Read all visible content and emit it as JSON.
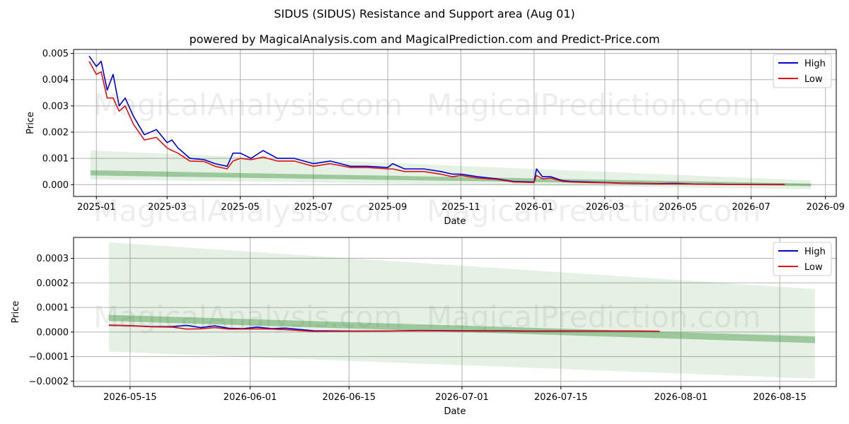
{
  "title": "SIDUS (SIDUS) Resistance and Support area (Aug 01)",
  "subtitle": "powered by MagicalAnalysis.com and MagicalPrediction.com and Predict-Price.com",
  "watermarks": [
    "MagicalAnalysis.com",
    "MagicalPrediction.com"
  ],
  "colors": {
    "high": "#0000cc",
    "low": "#dd1111",
    "band": "#2e8b2e",
    "grid": "#b0b0b0"
  },
  "chart_data": [
    {
      "type": "line",
      "xlabel": "Date",
      "ylabel": "Price",
      "xlim": [
        "2024-12-13",
        "2026-09-10"
      ],
      "ylim": [
        -0.00045,
        0.00515
      ],
      "x_ticks": [
        "2025-01",
        "2025-03",
        "2025-05",
        "2025-07",
        "2025-09",
        "2025-11",
        "2026-01",
        "2026-03",
        "2026-05",
        "2026-07",
        "2026-09"
      ],
      "y_ticks": [
        "0.000",
        "0.001",
        "0.002",
        "0.003",
        "0.004",
        "0.005"
      ],
      "legend": {
        "position": "top-right",
        "entries": [
          "High",
          "Low"
        ]
      },
      "grid": true,
      "series": [
        {
          "name": "High",
          "x": [
            "2024-12-26",
            "2025-01-01",
            "2025-01-05",
            "2025-01-10",
            "2025-01-15",
            "2025-01-20",
            "2025-01-25",
            "2025-02-01",
            "2025-02-10",
            "2025-02-20",
            "2025-03-01",
            "2025-03-05",
            "2025-03-10",
            "2025-03-20",
            "2025-04-01",
            "2025-04-10",
            "2025-04-20",
            "2025-04-25",
            "2025-05-01",
            "2025-05-10",
            "2025-05-20",
            "2025-06-01",
            "2025-06-15",
            "2025-07-01",
            "2025-07-15",
            "2025-08-01",
            "2025-08-15",
            "2025-09-01",
            "2025-09-05",
            "2025-09-15",
            "2025-10-01",
            "2025-10-15",
            "2025-10-25",
            "2025-11-01",
            "2025-11-15",
            "2025-12-01",
            "2025-12-15",
            "2026-01-01",
            "2026-01-03",
            "2026-01-08",
            "2026-01-15",
            "2026-01-25",
            "2026-02-01",
            "2026-02-15",
            "2026-03-01",
            "2026-03-15",
            "2026-04-01",
            "2026-04-15",
            "2026-04-28",
            "2026-05-15",
            "2026-06-01",
            "2026-06-15",
            "2026-07-01",
            "2026-07-15",
            "2026-07-29"
          ],
          "y": [
            0.0049,
            0.0045,
            0.0047,
            0.0036,
            0.0042,
            0.003,
            0.0033,
            0.0026,
            0.0019,
            0.0021,
            0.0016,
            0.0017,
            0.0014,
            0.001,
            0.00095,
            0.0008,
            0.0007,
            0.0012,
            0.0012,
            0.001,
            0.0013,
            0.001,
            0.001,
            0.0008,
            0.0009,
            0.0007,
            0.0007,
            0.00065,
            0.0008,
            0.0006,
            0.0006,
            0.0005,
            0.0004,
            0.0004,
            0.0003,
            0.00022,
            0.00012,
            0.0001,
            0.0006,
            0.0003,
            0.0003,
            0.00015,
            0.00012,
            0.0001,
            8e-05,
            6e-05,
            5e-05,
            4e-05,
            5e-05,
            2.5e-05,
            2e-05,
            1e-05,
            1e-05,
            6e-06,
            6e-06
          ]
        },
        {
          "name": "Low",
          "x": [
            "2024-12-26",
            "2025-01-01",
            "2025-01-05",
            "2025-01-10",
            "2025-01-15",
            "2025-01-20",
            "2025-01-25",
            "2025-02-01",
            "2025-02-10",
            "2025-02-20",
            "2025-03-01",
            "2025-03-05",
            "2025-03-10",
            "2025-03-20",
            "2025-04-01",
            "2025-04-10",
            "2025-04-20",
            "2025-04-25",
            "2025-05-01",
            "2025-05-10",
            "2025-05-20",
            "2025-06-01",
            "2025-06-15",
            "2025-07-01",
            "2025-07-15",
            "2025-08-01",
            "2025-08-15",
            "2025-09-01",
            "2025-09-05",
            "2025-09-15",
            "2025-10-01",
            "2025-10-15",
            "2025-10-25",
            "2025-11-01",
            "2025-11-15",
            "2025-12-01",
            "2025-12-15",
            "2026-01-01",
            "2026-01-03",
            "2026-01-08",
            "2026-01-15",
            "2026-01-25",
            "2026-02-01",
            "2026-02-15",
            "2026-03-01",
            "2026-03-15",
            "2026-04-01",
            "2026-04-15",
            "2026-04-28",
            "2026-05-15",
            "2026-06-01",
            "2026-06-15",
            "2026-07-01",
            "2026-07-15",
            "2026-07-29"
          ],
          "y": [
            0.0047,
            0.0042,
            0.0043,
            0.0033,
            0.0033,
            0.0028,
            0.003,
            0.0023,
            0.0017,
            0.0018,
            0.0014,
            0.0013,
            0.0012,
            0.0009,
            0.00088,
            0.0007,
            0.0006,
            0.0009,
            0.001,
            0.00095,
            0.00105,
            0.0009,
            0.0009,
            0.0007,
            0.0008,
            0.00065,
            0.00065,
            0.0006,
            0.0006,
            0.0005,
            0.0005,
            0.0004,
            0.0003,
            0.00035,
            0.00025,
            0.0002,
            0.0001,
            8e-05,
            0.00035,
            0.00022,
            0.00025,
            0.00012,
            0.0001,
            8e-05,
            7e-05,
            5e-05,
            4e-05,
            3e-05,
            3e-05,
            2e-05,
            1e-05,
            5e-06,
            5e-06,
            4e-06,
            5e-06
          ]
        }
      ],
      "bands": [
        {
          "x": [
            "2024-12-27",
            "2026-08-20"
          ],
          "upper": [
            0.0013,
            0.00016
          ],
          "lower": [
            0.0002,
            -0.00018
          ],
          "opacity": 0.12
        },
        {
          "x": [
            "2024-12-27",
            "2026-08-20"
          ],
          "upper": [
            0.00055,
            4e-05
          ],
          "lower": [
            0.00035,
            -6e-05
          ],
          "opacity": 0.4
        }
      ]
    },
    {
      "type": "line",
      "xlabel": "Date",
      "ylabel": "Price",
      "xlim": [
        "2026-05-07",
        "2026-08-23"
      ],
      "ylim": [
        -0.000222,
        0.000385
      ],
      "x_ticks": [
        "2026-05-15",
        "2026-06-01",
        "2026-06-15",
        "2026-07-01",
        "2026-07-15",
        "2026-08-01",
        "2026-08-15"
      ],
      "y_ticks": [
        "−0.0002",
        "−0.0001",
        "0.0000",
        "0.0001",
        "0.0002",
        "0.0003"
      ],
      "legend": {
        "position": "top-right",
        "entries": [
          "High",
          "Low"
        ]
      },
      "grid": true,
      "series": [
        {
          "name": "High",
          "x": [
            "2026-05-12",
            "2026-05-15",
            "2026-05-18",
            "2026-05-21",
            "2026-05-23",
            "2026-05-25",
            "2026-05-27",
            "2026-05-29",
            "2026-05-31",
            "2026-06-02",
            "2026-06-04",
            "2026-06-06",
            "2026-06-10",
            "2026-06-15",
            "2026-06-20",
            "2026-06-25",
            "2026-07-01",
            "2026-07-07",
            "2026-07-10",
            "2026-07-15",
            "2026-07-20",
            "2026-07-25",
            "2026-07-29"
          ],
          "y": [
            2.8e-05,
            2.6e-05,
            2.2e-05,
            2.2e-05,
            2.7e-05,
            1.8e-05,
            2.5e-05,
            1.5e-05,
            1.4e-05,
            2e-05,
            1.4e-05,
            1.6e-05,
            5e-06,
            4e-06,
            4e-06,
            6e-06,
            5e-06,
            5e-06,
            4e-06,
            4e-06,
            4e-06,
            4e-06,
            3e-06
          ]
        },
        {
          "name": "Low",
          "x": [
            "2026-05-12",
            "2026-05-15",
            "2026-05-18",
            "2026-05-21",
            "2026-05-23",
            "2026-05-25",
            "2026-05-27",
            "2026-05-29",
            "2026-05-31",
            "2026-06-02",
            "2026-06-04",
            "2026-06-06",
            "2026-06-10",
            "2026-06-15",
            "2026-06-20",
            "2026-06-25",
            "2026-07-01",
            "2026-07-07",
            "2026-07-10",
            "2026-07-15",
            "2026-07-20",
            "2026-07-25",
            "2026-07-29"
          ],
          "y": [
            2.7e-05,
            2.5e-05,
            2.1e-05,
            2e-05,
            1.2e-05,
            1.3e-05,
            1.8e-05,
            1.2e-05,
            1.2e-05,
            1.3e-05,
            1.2e-05,
            1e-05,
            2e-06,
            3e-06,
            4e-06,
            5e-06,
            4e-06,
            4e-06,
            3e-06,
            3e-06,
            4e-06,
            4e-06,
            3e-06
          ]
        }
      ],
      "bands": [
        {
          "x": [
            "2026-05-12",
            "2026-08-20"
          ],
          "upper": [
            0.000365,
            0.000175
          ],
          "lower": [
            -8e-05,
            -0.00019
          ],
          "opacity": 0.12
        },
        {
          "x": [
            "2026-05-12",
            "2026-08-20"
          ],
          "upper": [
            7e-05,
            -1.8e-05
          ],
          "lower": [
            4.5e-05,
            -4.5e-05
          ],
          "opacity": 0.4
        }
      ]
    }
  ]
}
